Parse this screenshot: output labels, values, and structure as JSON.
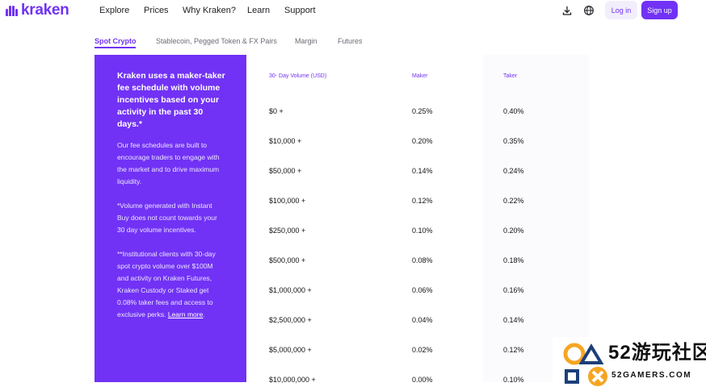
{
  "brand": {
    "name": "kraken",
    "color": "#7132f5"
  },
  "nav": {
    "links": [
      "Explore",
      "Prices",
      "Why Kraken?",
      "Learn",
      "Support"
    ],
    "login": "Log in",
    "signup": "Sign up",
    "icons": [
      "download-icon",
      "globe-icon"
    ]
  },
  "tabs": [
    "Spot Crypto",
    "Stablecoin, Pegged Token & FX Pairs",
    "Margin",
    "Futures"
  ],
  "panel": {
    "headline": "Kraken uses a maker-taker fee schedule with volume incentives based on your activity in the past 30 days.*",
    "p1": "Our fee schedules are built to encourage traders to engage with the market and to drive maximum liquidity.",
    "p2": "*Volume generated with Instant Buy does not count towards your 30 day volume incentives.",
    "p3": "**Institutional clients with 30-day spot crypto volume over $100M and activity on Kraken Futures, Kraken Custody or Staked get 0.08% taker fees and access to exclusive perks.",
    "link": "Learn more",
    "link_suffix": "."
  },
  "table": {
    "headers": [
      "30- Day Volume (USD)",
      "Maker",
      "Taker"
    ],
    "rows": [
      [
        "$0 +",
        "0.25%",
        "0.40%"
      ],
      [
        "$10,000 +",
        "0.20%",
        "0.35%"
      ],
      [
        "$50,000 +",
        "0.14%",
        "0.24%"
      ],
      [
        "$100,000 +",
        "0.12%",
        "0.22%"
      ],
      [
        "$250,000 +",
        "0.10%",
        "0.20%"
      ],
      [
        "$500,000 +",
        "0.08%",
        "0.18%"
      ],
      [
        "$1,000,000 +",
        "0.06%",
        "0.16%"
      ],
      [
        "$2,500,000 +",
        "0.04%",
        "0.14%"
      ],
      [
        "$5,000,000 +",
        "0.02%",
        "0.12%"
      ],
      [
        "$10,000,000 +",
        "0.00%",
        "0.10%"
      ]
    ]
  },
  "watermark": {
    "text": "52游玩社区",
    "sub": "52GAMERS.COM"
  }
}
